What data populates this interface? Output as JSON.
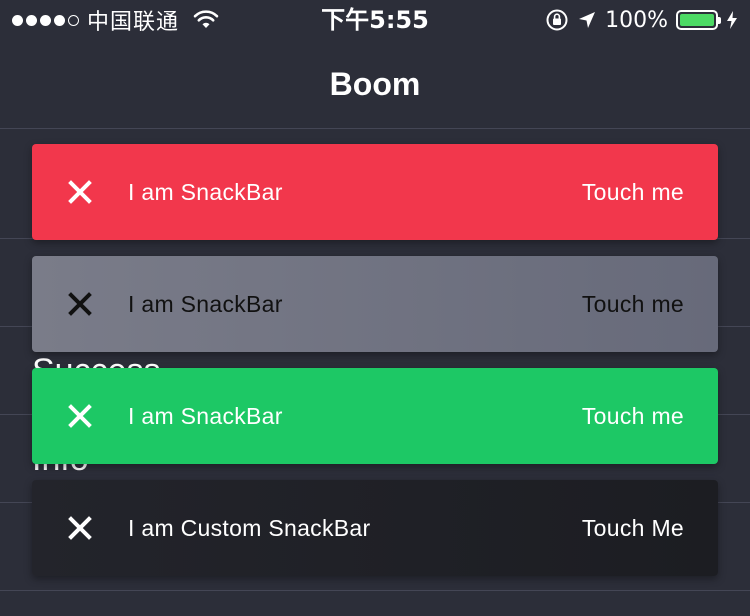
{
  "status_bar": {
    "carrier": "中国联通",
    "time": "下午5:55",
    "battery_percent": "100%",
    "battery_level": 1.0,
    "signal_bars_filled": 4,
    "signal_bars_total": 5,
    "icons": [
      "signal-dots",
      "wifi-icon",
      "orientation-lock-icon",
      "location-arrow-icon",
      "battery-icon",
      "charging-bolt-icon"
    ]
  },
  "nav": {
    "title": "Boom"
  },
  "list": {
    "items": [
      {
        "label": ""
      },
      {
        "label": ""
      },
      {
        "label": "Success"
      },
      {
        "label": "Info"
      }
    ]
  },
  "snackbars": [
    {
      "type": "error",
      "message": "I am SnackBar",
      "action": "Touch me",
      "color": "#f2374c",
      "close_icon": "close-icon"
    },
    {
      "type": "warning",
      "message": "I am SnackBar",
      "action": "Touch me",
      "color": "#6e7080",
      "close_icon": "close-icon"
    },
    {
      "type": "success",
      "message": "I am SnackBar",
      "action": "Touch me",
      "color": "#1dc865",
      "close_icon": "close-icon"
    },
    {
      "type": "custom",
      "message": "I am Custom SnackBar",
      "action": "Touch Me",
      "color": "#202126",
      "close_icon": "close-icon"
    }
  ],
  "colors": {
    "background": "#2c2e39",
    "divider": "#444655",
    "battery_green": "#4cd964"
  }
}
